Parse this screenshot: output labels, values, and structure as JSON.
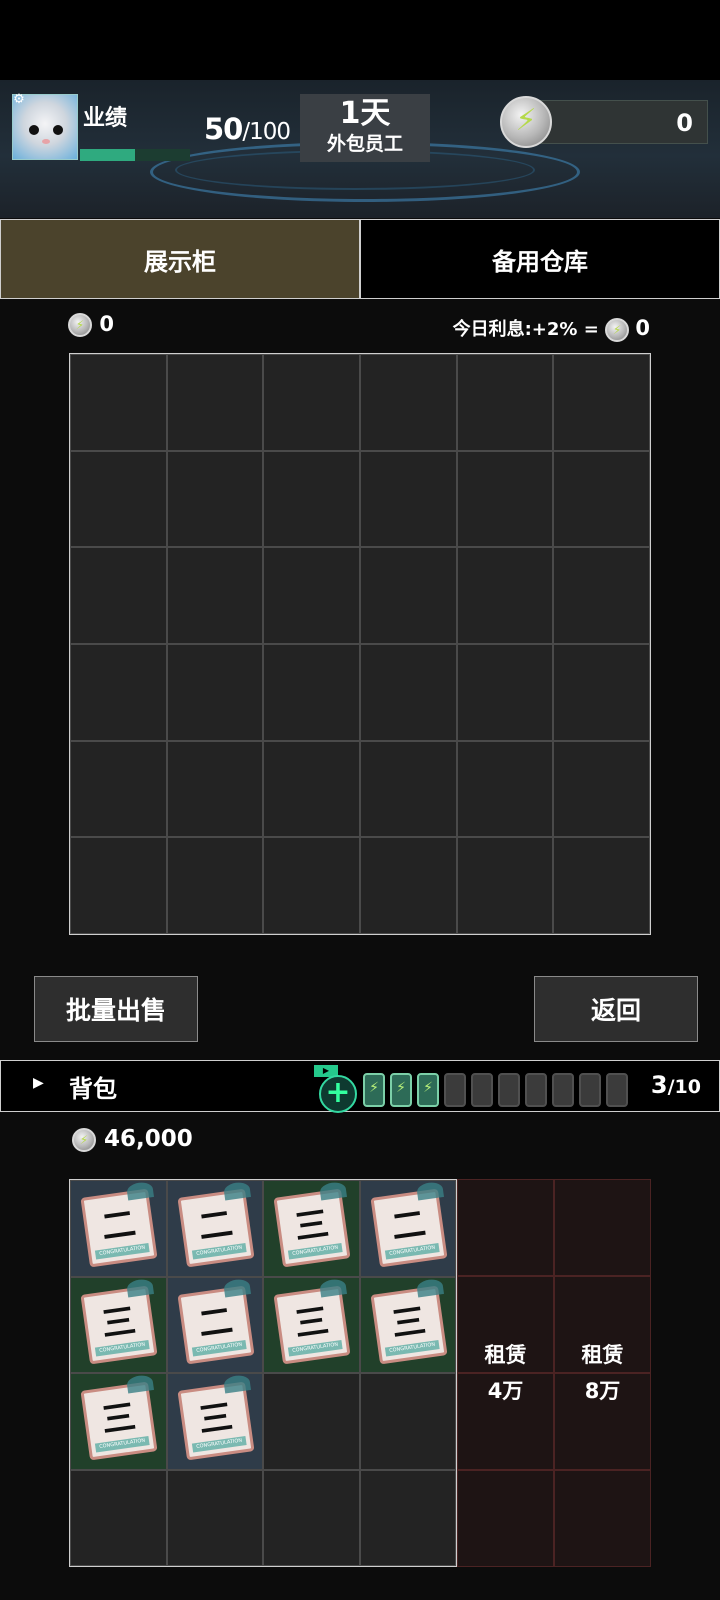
{
  "header": {
    "perf_label": "业绩",
    "perf_progress": 0.5,
    "score_current": "50",
    "score_total": "/100",
    "day": "1天",
    "role": "外包员工",
    "energy_value": "0"
  },
  "tabs": [
    {
      "label": "展示柜",
      "active": true
    },
    {
      "label": "备用仓库",
      "active": false
    }
  ],
  "display": {
    "coin_value": "0",
    "interest_label": "今日利息:+2% =",
    "interest_value": "0",
    "rows": 6,
    "cols": 6
  },
  "buttons": {
    "bulk_sell": "批量出售",
    "back": "返回"
  },
  "bag": {
    "label": "背包",
    "ad_tag": "▶",
    "count_current": "3",
    "count_total": "/10",
    "batteries_full": 3,
    "batteries_total": 10,
    "money": "46,000",
    "items": [
      {
        "num": "二",
        "bg": "blue"
      },
      {
        "num": "二",
        "bg": "blue"
      },
      {
        "num": "三",
        "bg": "green"
      },
      {
        "num": "二",
        "bg": "blue"
      },
      {
        "num": "三",
        "bg": "green"
      },
      {
        "num": "二",
        "bg": "blue"
      },
      {
        "num": "三",
        "bg": "green"
      },
      {
        "num": "三",
        "bg": "green"
      },
      {
        "num": "三",
        "bg": "green"
      },
      {
        "num": "三",
        "bg": "blue"
      }
    ],
    "card_ribbon": "CONGRATULATION"
  },
  "rent": [
    {
      "label": "租赁",
      "price": "4万"
    },
    {
      "label": "租赁",
      "price": "8万"
    }
  ],
  "colors": {
    "accent": "#2faa7f",
    "tab_active": "#4b432c"
  }
}
